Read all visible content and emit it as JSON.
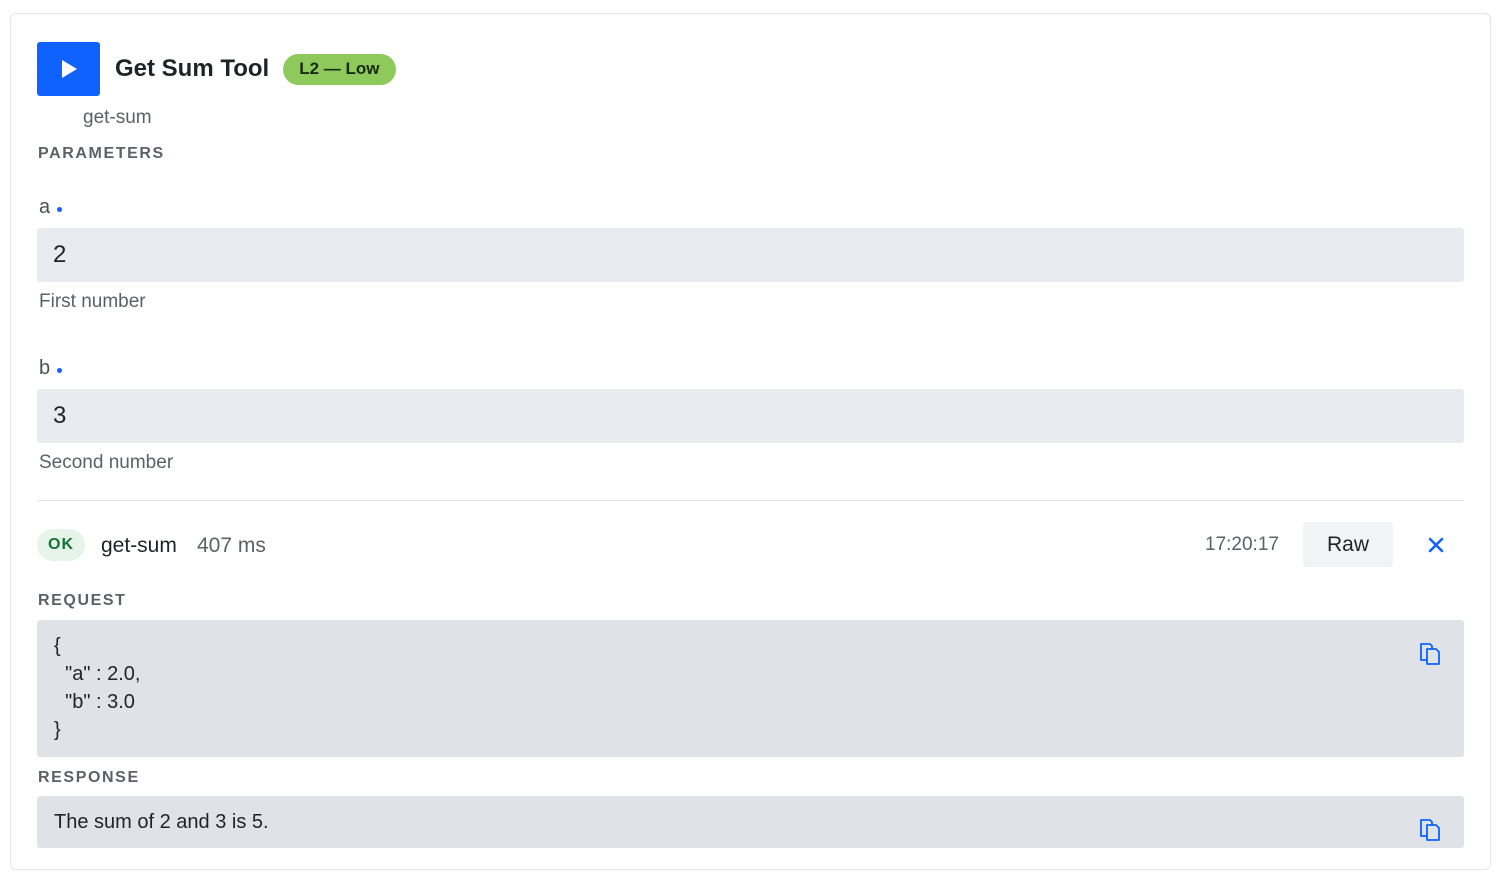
{
  "tool": {
    "title": "Get Sum Tool",
    "risk_badge": "L2 — Low",
    "id": "get-sum"
  },
  "parameters": {
    "section_label": "PARAMETERS",
    "items": [
      {
        "name": "a",
        "value": "2",
        "help": "First number"
      },
      {
        "name": "b",
        "value": "3",
        "help": "Second number"
      }
    ]
  },
  "result": {
    "status": "OK",
    "tool": "get-sum",
    "duration": "407 ms",
    "time": "17:20:17",
    "raw_label": "Raw",
    "request_label": "REQUEST",
    "request_lines": [
      "{",
      "  \"a\" : 2.0,",
      "  \"b\" : 3.0",
      "}"
    ],
    "response_label": "RESPONSE",
    "response_text": "The sum of 2 and 3 is 5."
  },
  "colors": {
    "accent": "#0f62fe",
    "risk_low": "#8dc95b",
    "status_ok_bg": "#e6f4ea",
    "status_ok_text": "#137333"
  },
  "icons": {
    "run": "play-icon",
    "close": "close-icon",
    "copy": "copy-icon"
  }
}
